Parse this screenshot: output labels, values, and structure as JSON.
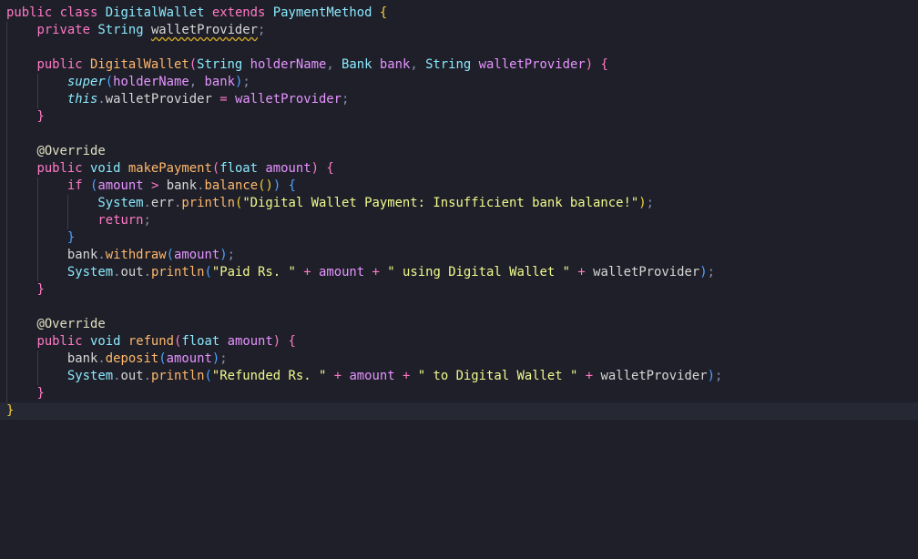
{
  "theme": {
    "background": "#1e1f29",
    "current_line_background": "#262833",
    "colors": {
      "kw": "#ff79c6",
      "type": "#8be9fd",
      "cls": "#8be9fd",
      "fn": "#ffb86c",
      "param": "#e694ff",
      "str": "#f1fa8c",
      "punc": "#8a8ea6",
      "plain": "#d6d6d6",
      "annot": "#e0e0c0",
      "brace1": "#f1d23a",
      "brace2": "#ff79c6",
      "brace3": "#4fa3ff"
    }
  },
  "editor": {
    "language": "Java",
    "lines": [
      [
        [
          "public",
          "kw"
        ],
        [
          " ",
          "plain"
        ],
        [
          "class",
          "kw"
        ],
        [
          " ",
          "plain"
        ],
        [
          "DigitalWallet",
          "cls"
        ],
        [
          " ",
          "plain"
        ],
        [
          "extends",
          "kw"
        ],
        [
          " ",
          "plain"
        ],
        [
          "PaymentMethod",
          "cls"
        ],
        [
          " ",
          "plain"
        ],
        [
          "{",
          "brace1"
        ]
      ],
      [
        [
          "    ",
          "plain"
        ],
        [
          "private",
          "kw"
        ],
        [
          " ",
          "plain"
        ],
        [
          "String",
          "type"
        ],
        [
          " ",
          "plain"
        ],
        [
          "walletProvider",
          "plain",
          "squiggle"
        ],
        [
          ";",
          "punc"
        ]
      ],
      [],
      [
        [
          "    ",
          "plain"
        ],
        [
          "public",
          "kw"
        ],
        [
          " ",
          "plain"
        ],
        [
          "DigitalWallet",
          "fn"
        ],
        [
          "(",
          "brace2"
        ],
        [
          "String",
          "type"
        ],
        [
          " ",
          "plain"
        ],
        [
          "holderName",
          "param"
        ],
        [
          ", ",
          "punc"
        ],
        [
          "Bank",
          "type"
        ],
        [
          " ",
          "plain"
        ],
        [
          "bank",
          "param"
        ],
        [
          ", ",
          "punc"
        ],
        [
          "String",
          "type"
        ],
        [
          " ",
          "plain"
        ],
        [
          "walletProvider",
          "param"
        ],
        [
          ")",
          "brace2"
        ],
        [
          " ",
          "plain"
        ],
        [
          "{",
          "brace2"
        ]
      ],
      [
        [
          "        ",
          "plain"
        ],
        [
          "super",
          "type",
          "it"
        ],
        [
          "(",
          "brace3"
        ],
        [
          "holderName",
          "param"
        ],
        [
          ", ",
          "punc"
        ],
        [
          "bank",
          "param"
        ],
        [
          ")",
          "brace3"
        ],
        [
          ";",
          "punc"
        ]
      ],
      [
        [
          "        ",
          "plain"
        ],
        [
          "this",
          "type",
          "it"
        ],
        [
          ".",
          "punc"
        ],
        [
          "walletProvider",
          "plain"
        ],
        [
          " ",
          "plain"
        ],
        [
          "=",
          "kw"
        ],
        [
          " ",
          "plain"
        ],
        [
          "walletProvider",
          "param"
        ],
        [
          ";",
          "punc"
        ]
      ],
      [
        [
          "    ",
          "plain"
        ],
        [
          "}",
          "brace2"
        ]
      ],
      [],
      [
        [
          "    ",
          "plain"
        ],
        [
          "@Override",
          "annot"
        ]
      ],
      [
        [
          "    ",
          "plain"
        ],
        [
          "public",
          "kw"
        ],
        [
          " ",
          "plain"
        ],
        [
          "void",
          "type"
        ],
        [
          " ",
          "plain"
        ],
        [
          "makePayment",
          "fn"
        ],
        [
          "(",
          "brace2"
        ],
        [
          "float",
          "type"
        ],
        [
          " ",
          "plain"
        ],
        [
          "amount",
          "param"
        ],
        [
          ")",
          "brace2"
        ],
        [
          " ",
          "plain"
        ],
        [
          "{",
          "brace2"
        ]
      ],
      [
        [
          "        ",
          "plain"
        ],
        [
          "if",
          "kw"
        ],
        [
          " ",
          "plain"
        ],
        [
          "(",
          "brace3"
        ],
        [
          "amount",
          "param"
        ],
        [
          " ",
          "plain"
        ],
        [
          ">",
          "kw"
        ],
        [
          " ",
          "plain"
        ],
        [
          "bank",
          "plain"
        ],
        [
          ".",
          "punc"
        ],
        [
          "balance",
          "fn"
        ],
        [
          "()",
          "brace1"
        ],
        [
          ")",
          "brace3"
        ],
        [
          " ",
          "plain"
        ],
        [
          "{",
          "brace3"
        ]
      ],
      [
        [
          "            ",
          "plain"
        ],
        [
          "System",
          "type"
        ],
        [
          ".",
          "punc"
        ],
        [
          "err",
          "plain"
        ],
        [
          ".",
          "punc"
        ],
        [
          "println",
          "fn"
        ],
        [
          "(",
          "brace1"
        ],
        [
          "\"Digital Wallet Payment: Insufficient bank balance!\"",
          "str"
        ],
        [
          ")",
          "brace1"
        ],
        [
          ";",
          "punc"
        ]
      ],
      [
        [
          "            ",
          "plain"
        ],
        [
          "return",
          "kw"
        ],
        [
          ";",
          "punc"
        ]
      ],
      [
        [
          "        ",
          "plain"
        ],
        [
          "}",
          "brace3"
        ]
      ],
      [
        [
          "        ",
          "plain"
        ],
        [
          "bank",
          "plain"
        ],
        [
          ".",
          "punc"
        ],
        [
          "withdraw",
          "fn"
        ],
        [
          "(",
          "brace3"
        ],
        [
          "amount",
          "param"
        ],
        [
          ")",
          "brace3"
        ],
        [
          ";",
          "punc"
        ]
      ],
      [
        [
          "        ",
          "plain"
        ],
        [
          "System",
          "type"
        ],
        [
          ".",
          "punc"
        ],
        [
          "out",
          "plain"
        ],
        [
          ".",
          "punc"
        ],
        [
          "println",
          "fn"
        ],
        [
          "(",
          "brace3"
        ],
        [
          "\"Paid Rs. \"",
          "str"
        ],
        [
          " ",
          "plain"
        ],
        [
          "+",
          "kw"
        ],
        [
          " ",
          "plain"
        ],
        [
          "amount",
          "param"
        ],
        [
          " ",
          "plain"
        ],
        [
          "+",
          "kw"
        ],
        [
          " ",
          "plain"
        ],
        [
          "\" using Digital Wallet \"",
          "str"
        ],
        [
          " ",
          "plain"
        ],
        [
          "+",
          "kw"
        ],
        [
          " ",
          "plain"
        ],
        [
          "walletProvider",
          "plain"
        ],
        [
          ")",
          "brace3"
        ],
        [
          ";",
          "punc"
        ]
      ],
      [
        [
          "    ",
          "plain"
        ],
        [
          "}",
          "brace2"
        ]
      ],
      [],
      [
        [
          "    ",
          "plain"
        ],
        [
          "@Override",
          "annot"
        ]
      ],
      [
        [
          "    ",
          "plain"
        ],
        [
          "public",
          "kw"
        ],
        [
          " ",
          "plain"
        ],
        [
          "void",
          "type"
        ],
        [
          " ",
          "plain"
        ],
        [
          "refund",
          "fn"
        ],
        [
          "(",
          "brace2"
        ],
        [
          "float",
          "type"
        ],
        [
          " ",
          "plain"
        ],
        [
          "amount",
          "param"
        ],
        [
          ")",
          "brace2"
        ],
        [
          " ",
          "plain"
        ],
        [
          "{",
          "brace2"
        ]
      ],
      [
        [
          "        ",
          "plain"
        ],
        [
          "bank",
          "plain"
        ],
        [
          ".",
          "punc"
        ],
        [
          "deposit",
          "fn"
        ],
        [
          "(",
          "brace3"
        ],
        [
          "amount",
          "param"
        ],
        [
          ")",
          "brace3"
        ],
        [
          ";",
          "punc"
        ]
      ],
      [
        [
          "        ",
          "plain"
        ],
        [
          "System",
          "type"
        ],
        [
          ".",
          "punc"
        ],
        [
          "out",
          "plain"
        ],
        [
          ".",
          "punc"
        ],
        [
          "println",
          "fn"
        ],
        [
          "(",
          "brace3"
        ],
        [
          "\"Refunded Rs. \"",
          "str"
        ],
        [
          " ",
          "plain"
        ],
        [
          "+",
          "kw"
        ],
        [
          " ",
          "plain"
        ],
        [
          "amount",
          "param"
        ],
        [
          " ",
          "plain"
        ],
        [
          "+",
          "kw"
        ],
        [
          " ",
          "plain"
        ],
        [
          "\" to Digital Wallet \"",
          "str"
        ],
        [
          " ",
          "plain"
        ],
        [
          "+",
          "kw"
        ],
        [
          " ",
          "plain"
        ],
        [
          "walletProvider",
          "plain"
        ],
        [
          ")",
          "brace3"
        ],
        [
          ";",
          "punc"
        ]
      ],
      [
        [
          "    ",
          "plain"
        ],
        [
          "}",
          "brace2"
        ]
      ],
      [
        [
          "}",
          "brace1"
        ]
      ]
    ]
  }
}
